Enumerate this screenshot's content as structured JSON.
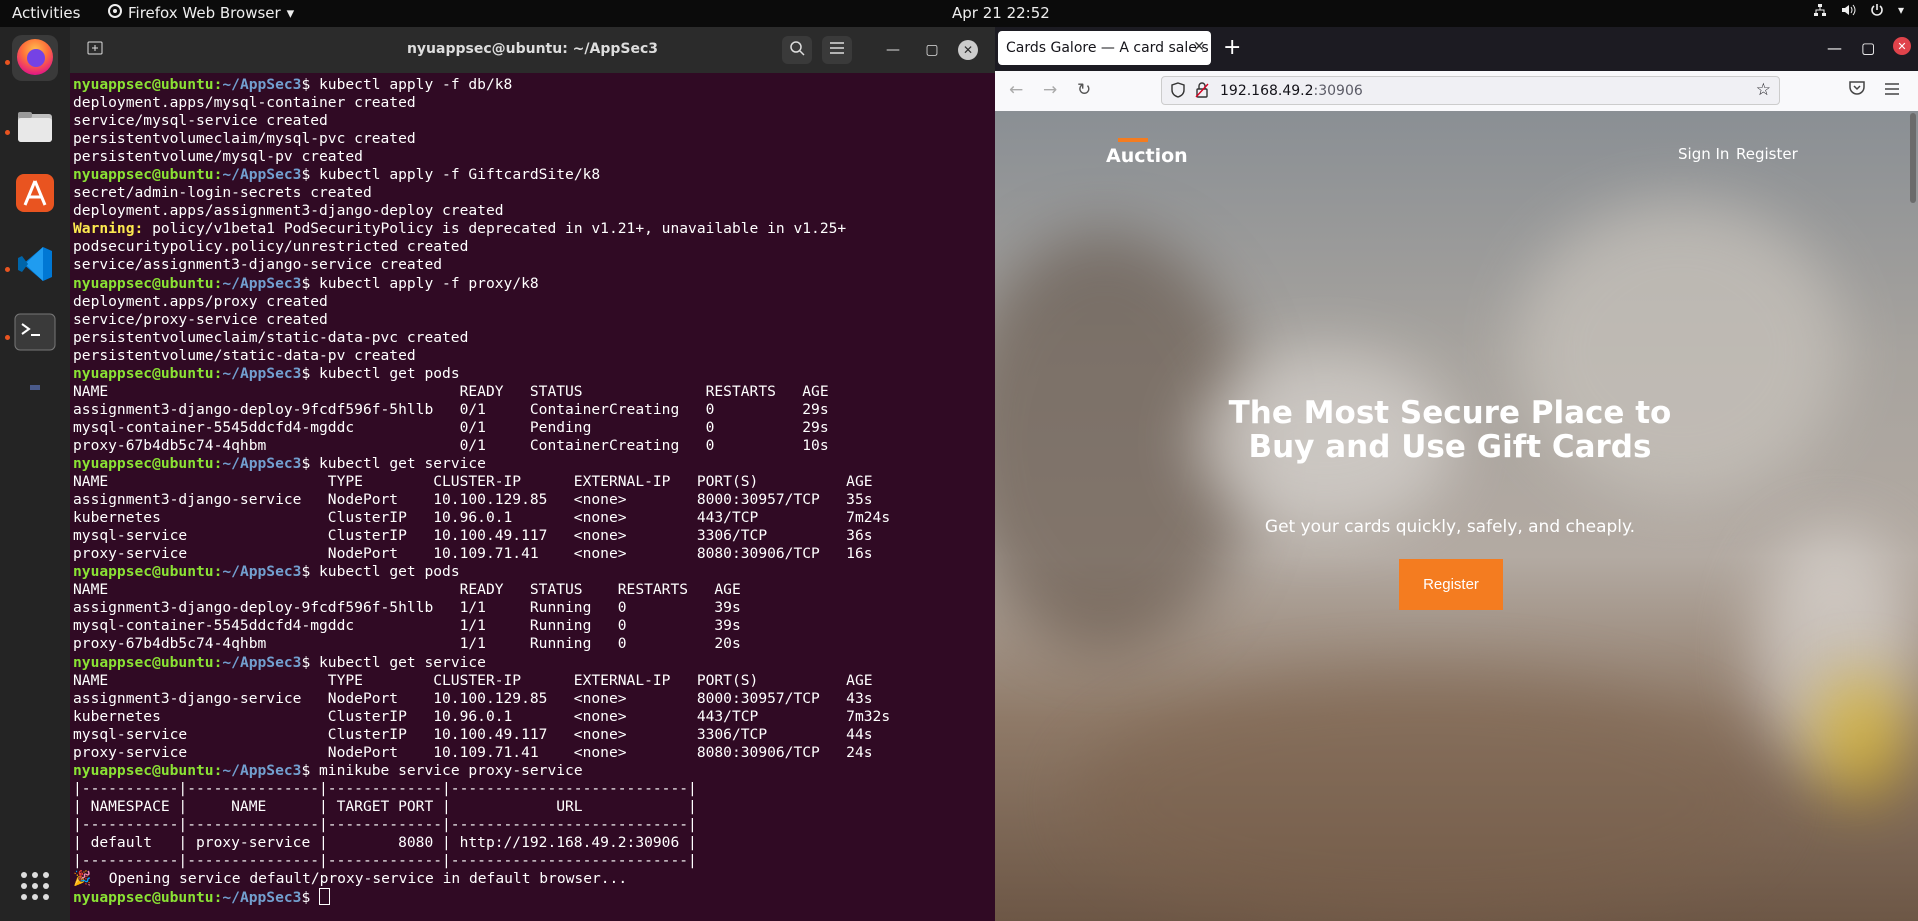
{
  "topbar": {
    "activities": "Activities",
    "app_name": "Firefox Web Browser",
    "clock": "Apr 21  22:52",
    "tray_icons": [
      "network-icon",
      "volume-icon",
      "power-icon"
    ]
  },
  "dock": {
    "apps": [
      "firefox",
      "files",
      "app-center",
      "vscode",
      "terminal"
    ],
    "grid_label": "Show Applications"
  },
  "terminal": {
    "title": "nyuappsec@ubuntu: ~/AppSec3",
    "prompt_user": "nyuappsec@ubuntu",
    "prompt_path": "~/AppSec3",
    "lines": [
      {
        "cmd": "kubectl apply -f db/k8"
      },
      {
        "out": "deployment.apps/mysql-container created"
      },
      {
        "out": "service/mysql-service created"
      },
      {
        "out": "persistentvolumeclaim/mysql-pvc created"
      },
      {
        "out": "persistentvolume/mysql-pv created"
      },
      {
        "cmd": "kubectl apply -f GiftcardSite/k8"
      },
      {
        "out": "secret/admin-login-secrets created"
      },
      {
        "out": "deployment.apps/assignment3-django-deploy created"
      },
      {
        "warn": "Warning:",
        "out": " policy/v1beta1 PodSecurityPolicy is deprecated in v1.21+, unavailable in v1.25+"
      },
      {
        "out": "podsecuritypolicy.policy/unrestricted created"
      },
      {
        "out": "service/assignment3-django-service created"
      },
      {
        "cmd": "kubectl apply -f proxy/k8"
      },
      {
        "out": "deployment.apps/proxy created"
      },
      {
        "out": "service/proxy-service created"
      },
      {
        "out": "persistentvolumeclaim/static-data-pvc created"
      },
      {
        "out": "persistentvolume/static-data-pv created"
      },
      {
        "cmd": "kubectl get pods"
      },
      {
        "out": "NAME                                        READY   STATUS              RESTARTS   AGE"
      },
      {
        "out": "assignment3-django-deploy-9fcdf596f-5hllb   0/1     ContainerCreating   0          29s"
      },
      {
        "out": "mysql-container-5545ddcfd4-mgddc            0/1     Pending             0          29s"
      },
      {
        "out": "proxy-67b4db5c74-4qhbm                      0/1     ContainerCreating   0          10s"
      },
      {
        "cmd": "kubectl get service"
      },
      {
        "out": "NAME                         TYPE        CLUSTER-IP      EXTERNAL-IP   PORT(S)          AGE"
      },
      {
        "out": "assignment3-django-service   NodePort    10.100.129.85   <none>        8000:30957/TCP   35s"
      },
      {
        "out": "kubernetes                   ClusterIP   10.96.0.1       <none>        443/TCP          7m24s"
      },
      {
        "out": "mysql-service                ClusterIP   10.100.49.117   <none>        3306/TCP         36s"
      },
      {
        "out": "proxy-service                NodePort    10.109.71.41    <none>        8080:30906/TCP   16s"
      },
      {
        "cmd": "kubectl get pods"
      },
      {
        "out": "NAME                                        READY   STATUS    RESTARTS   AGE"
      },
      {
        "out": "assignment3-django-deploy-9fcdf596f-5hllb   1/1     Running   0          39s"
      },
      {
        "out": "mysql-container-5545ddcfd4-mgddc            1/1     Running   0          39s"
      },
      {
        "out": "proxy-67b4db5c74-4qhbm                      1/1     Running   0          20s"
      },
      {
        "cmd": "kubectl get service"
      },
      {
        "out": "NAME                         TYPE        CLUSTER-IP      EXTERNAL-IP   PORT(S)          AGE"
      },
      {
        "out": "assignment3-django-service   NodePort    10.100.129.85   <none>        8000:30957/TCP   43s"
      },
      {
        "out": "kubernetes                   ClusterIP   10.96.0.1       <none>        443/TCP          7m32s"
      },
      {
        "out": "mysql-service                ClusterIP   10.100.49.117   <none>        3306/TCP         44s"
      },
      {
        "out": "proxy-service                NodePort    10.109.71.41    <none>        8080:30906/TCP   24s"
      },
      {
        "cmd": "minikube service proxy-service"
      },
      {
        "out": "|-----------|---------------|-------------|---------------------------|"
      },
      {
        "out": "| NAMESPACE |     NAME      | TARGET PORT |            URL            |"
      },
      {
        "out": "|-----------|---------------|-------------|---------------------------|"
      },
      {
        "out": "| default   | proxy-service |        8080 | http://192.168.49.2:30906 |"
      },
      {
        "out": "|-----------|---------------|-------------|---------------------------|"
      },
      {
        "out": "🎉  Opening service default/proxy-service in default browser..."
      },
      {
        "cmd": "",
        "cursor": true
      }
    ]
  },
  "firefox": {
    "tab_title": "Cards Galore — A card sale s",
    "url_host": "192.168.49.2",
    "url_port": ":30906",
    "site": {
      "logo": "Auction",
      "nav_signin": "Sign In",
      "nav_register": "Register",
      "hero_title": "The Most Secure Place to Buy and Use Gift Cards",
      "hero_subtitle": "Get your cards quickly, safely, and cheaply.",
      "hero_button": "Register"
    },
    "accent": "#f47c20"
  }
}
